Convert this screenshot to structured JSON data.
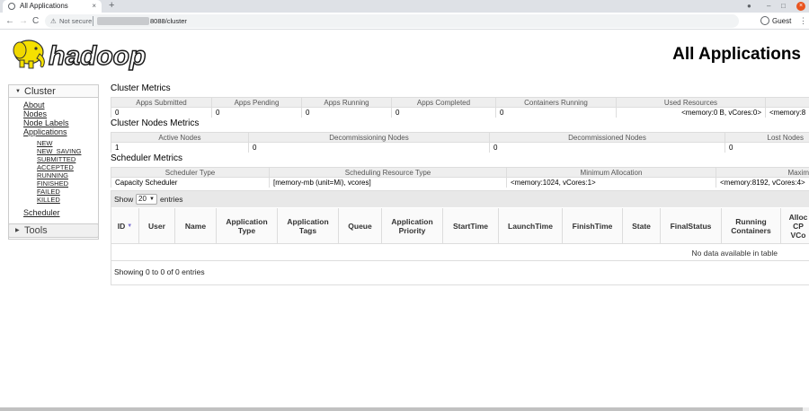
{
  "browser": {
    "tab_title": "All Applications",
    "tab_close": "×",
    "new_tab": "+",
    "nav_back": "←",
    "nav_forward": "→",
    "nav_reload": "C",
    "security_label": "Not secure",
    "url_path": "8088/cluster",
    "profile_label": "Guest",
    "menu_glyph": "⋮",
    "win_minimize": "–",
    "win_restore": "□",
    "win_close": "×"
  },
  "page": {
    "logo_text": "hadoop",
    "title": "All Applications"
  },
  "sidebar": {
    "cluster_label": "Cluster",
    "links": [
      "About",
      "Nodes",
      "Node Labels",
      "Applications"
    ],
    "app_states": [
      "NEW",
      "NEW_SAVING",
      "SUBMITTED",
      "ACCEPTED",
      "RUNNING",
      "FINISHED",
      "FAILED",
      "KILLED"
    ],
    "scheduler": "Scheduler",
    "tools_label": "Tools"
  },
  "cluster_metrics": {
    "title": "Cluster Metrics",
    "headers": [
      "Apps Submitted",
      "Apps Pending",
      "Apps Running",
      "Apps Completed",
      "Containers Running",
      "Used Resources",
      ""
    ],
    "values": [
      "0",
      "0",
      "0",
      "0",
      "0",
      "<memory:0 B, vCores:0>",
      "<memory:8"
    ]
  },
  "nodes_metrics": {
    "title": "Cluster Nodes Metrics",
    "headers": [
      "Active Nodes",
      "Decommissioning Nodes",
      "Decommissioned Nodes",
      "Lost Nodes"
    ],
    "values": [
      "1",
      "0",
      "0",
      "0"
    ]
  },
  "scheduler_metrics": {
    "title": "Scheduler Metrics",
    "headers": [
      "Scheduler Type",
      "Scheduling Resource Type",
      "Minimum Allocation",
      "Maxim"
    ],
    "values": [
      "Capacity Scheduler",
      "[memory-mb (unit=Mi), vcores]",
      "<memory:1024, vCores:1>",
      "<memory:8192, vCores:4>"
    ]
  },
  "apps_table": {
    "show_label": "Show",
    "page_size": "20",
    "entries_label": "entries",
    "columns": [
      "ID",
      "User",
      "Name",
      "Application\nType",
      "Application\nTags",
      "Queue",
      "Application\nPriority",
      "StartTime",
      "LaunchTime",
      "FinishTime",
      "State",
      "FinalStatus",
      "Running\nContainers",
      "Alloc\nCP\nVCo"
    ],
    "sort_indicator": "▼",
    "empty_message": "No data available in table",
    "info": "Showing 0 to 0 of 0 entries"
  }
}
